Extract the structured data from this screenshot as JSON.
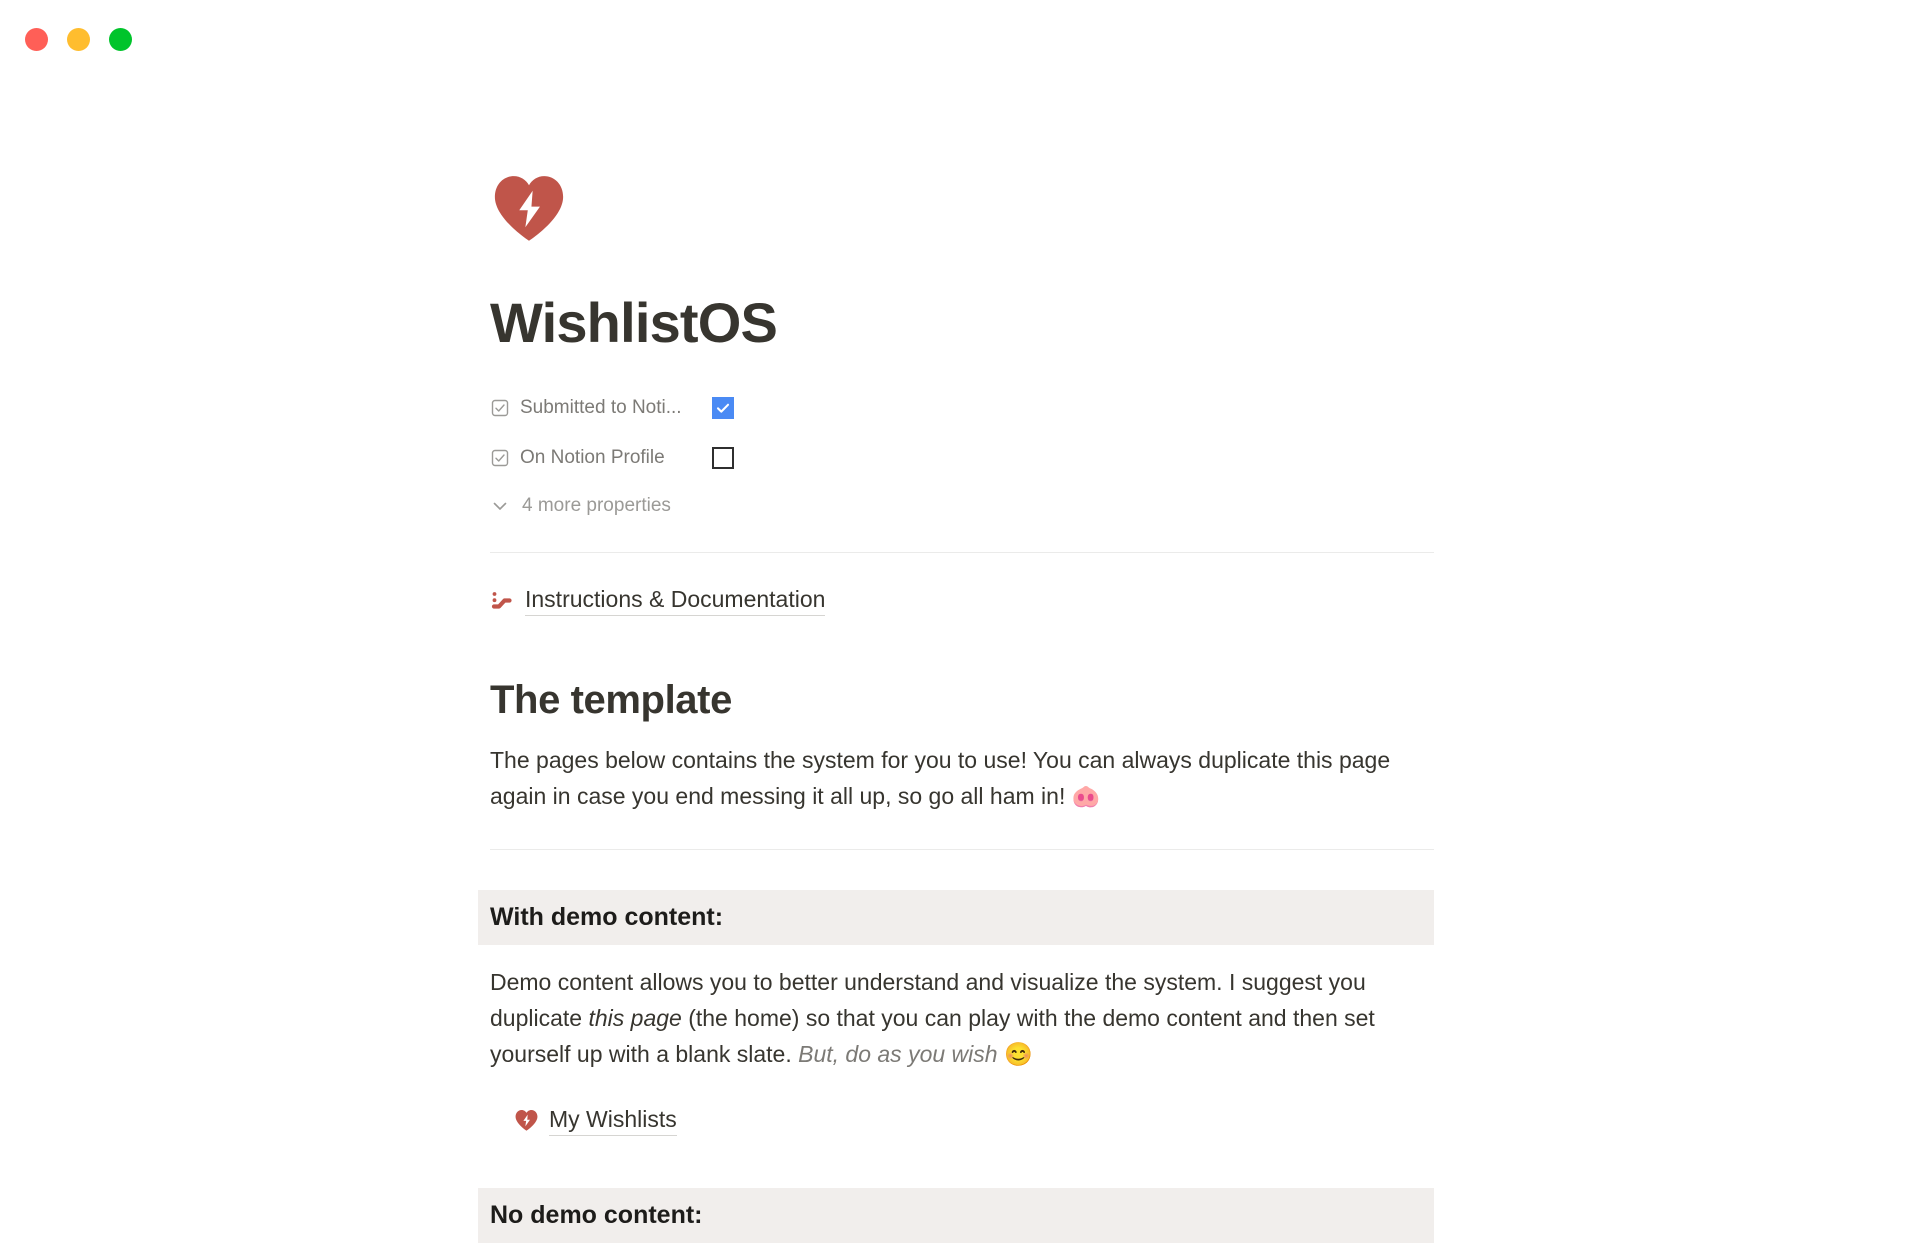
{
  "window": {
    "traffic_lights": [
      {
        "name": "close",
        "color": "#ff5f57"
      },
      {
        "name": "minimize",
        "color": "#ffbd2e"
      },
      {
        "name": "maximize",
        "color": "#00c42b"
      }
    ]
  },
  "page": {
    "icon": "heart-bolt-icon",
    "icon_color": "#c0554a",
    "title": "WishlistOS"
  },
  "properties": {
    "rows": [
      {
        "icon": "checkbox-property-icon",
        "label": "Submitted to Noti...",
        "type": "checkbox",
        "checked": true,
        "checked_color": "#4a8af4"
      },
      {
        "icon": "checkbox-property-icon",
        "label": "On Notion Profile",
        "type": "checkbox",
        "checked": false
      }
    ],
    "more_label": "4 more properties",
    "more_icon": "chevron-down-icon"
  },
  "links": {
    "instructions": {
      "icon": "escalator-icon",
      "label": "Instructions & Documentation"
    },
    "my_wishlists": {
      "icon": "heart-bolt-icon",
      "label": "My Wishlists"
    }
  },
  "main": {
    "heading": "The template",
    "intro_text": "The pages below contains the system for you to use! You can always duplicate this page again in case you end messing it all up, so go all ham in! ",
    "intro_emoji": "🐽",
    "with_demo": {
      "heading": "With demo content:",
      "text_part1": "Demo content allows you to better understand and visualize the system. I suggest you duplicate ",
      "text_italic1": "this page",
      "text_part2": " (the home) so that you can play with the demo content and then set yourself up with a blank slate. ",
      "text_italic2": "But, do as you wish",
      "text_emoji": " 😊"
    },
    "no_demo": {
      "heading": "No demo content:"
    }
  }
}
